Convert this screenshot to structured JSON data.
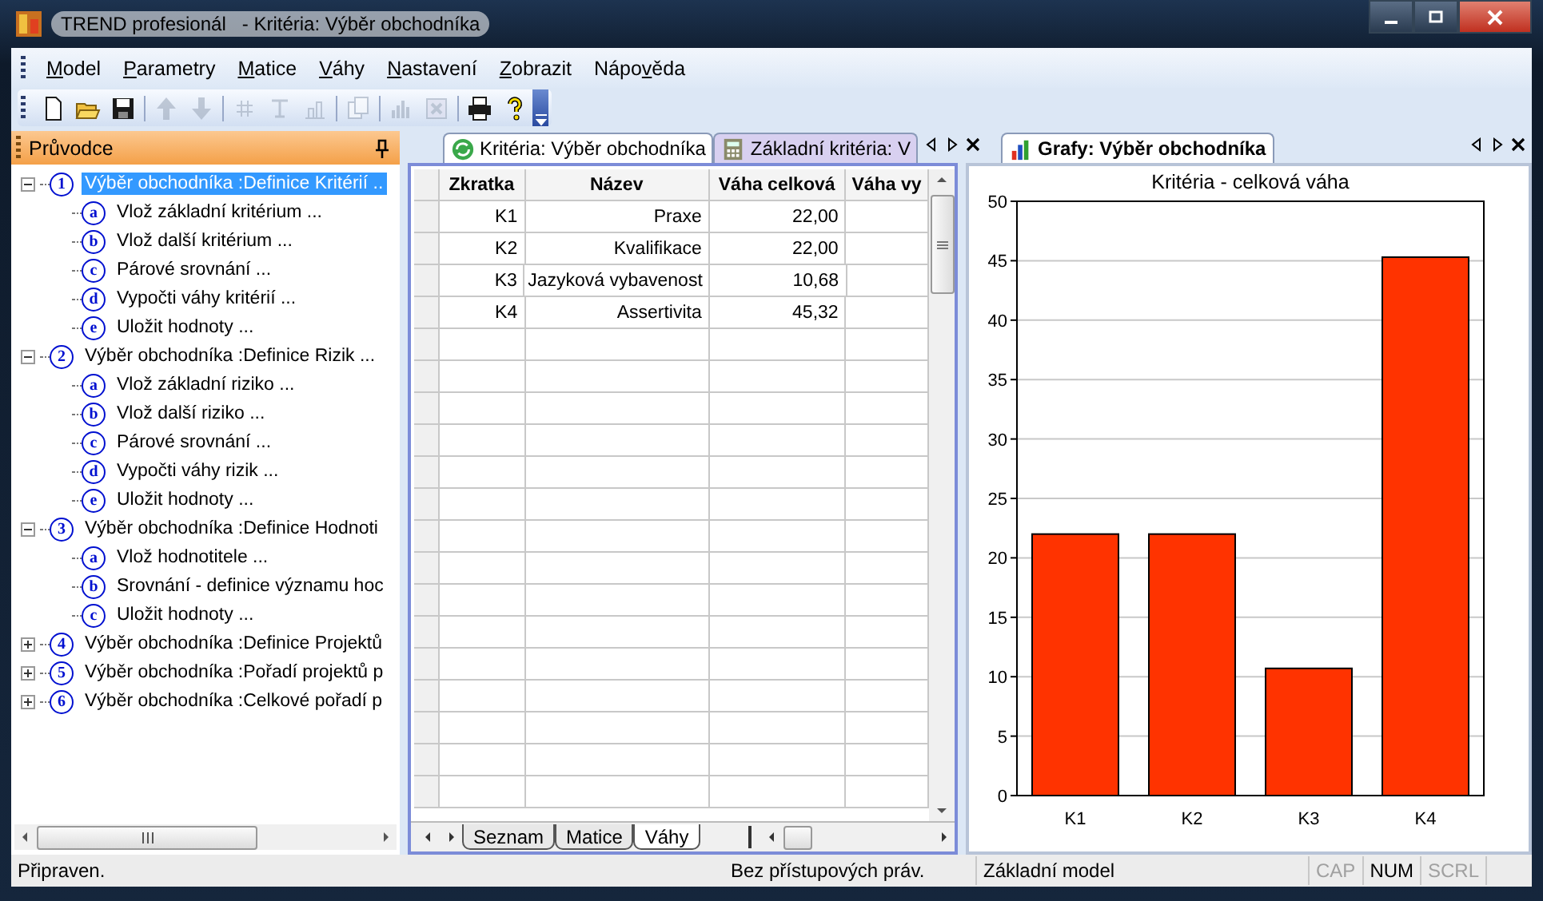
{
  "window": {
    "app_title": "TREND profesionál",
    "doc_title": "- Kritéria: Výběr obchodníka"
  },
  "menu": [
    {
      "access_key": "M",
      "rest": "odel"
    },
    {
      "access_key": "P",
      "rest": "arametry"
    },
    {
      "access_key": "M",
      "rest": "atice"
    },
    {
      "access_key": "V",
      "rest": "áhy"
    },
    {
      "access_key": "N",
      "rest": "astavení"
    },
    {
      "access_key": "Z",
      "rest": "obrazit"
    },
    {
      "before": "Nápo",
      "access_key": "v",
      "rest": "ěda"
    }
  ],
  "toolbar": [
    {
      "kind": "new",
      "disabled": false
    },
    {
      "kind": "open",
      "disabled": false
    },
    {
      "kind": "save",
      "disabled": false
    },
    {
      "kind": "separator"
    },
    {
      "kind": "up",
      "disabled": true
    },
    {
      "kind": "down",
      "disabled": true
    },
    {
      "kind": "separator"
    },
    {
      "kind": "hash",
      "disabled": true
    },
    {
      "kind": "text",
      "disabled": true
    },
    {
      "kind": "chart",
      "disabled": true
    },
    {
      "kind": "separator"
    },
    {
      "kind": "copy",
      "disabled": true
    },
    {
      "kind": "separator"
    },
    {
      "kind": "bars",
      "disabled": true
    },
    {
      "kind": "delete",
      "disabled": true
    },
    {
      "kind": "separator"
    },
    {
      "kind": "print",
      "disabled": false
    },
    {
      "kind": "help",
      "disabled": false
    }
  ],
  "wizard": {
    "title": "Průvodce",
    "items": [
      {
        "badge": "1",
        "label": "Výběr obchodníka :Definice Kritérií ..",
        "expanded": true,
        "selected": true,
        "children": [
          {
            "badge": "a",
            "label": "Vlož základní kritérium ...",
            "selected": false
          },
          {
            "badge": "b",
            "label": "Vlož další kritérium ...",
            "selected": false
          },
          {
            "badge": "c",
            "label": "Párové srovnání ...",
            "selected": false
          },
          {
            "badge": "d",
            "label": "Vypočti váhy kritérií ...",
            "selected": false
          },
          {
            "badge": "e",
            "label": "Uložit hodnoty ...",
            "selected": false
          }
        ]
      },
      {
        "badge": "2",
        "label": "Výběr obchodníka :Definice Rizik ...",
        "expanded": true,
        "selected": false,
        "children": [
          {
            "badge": "a",
            "label": "Vlož základní riziko ...",
            "selected": false
          },
          {
            "badge": "b",
            "label": "Vlož další riziko ...",
            "selected": false
          },
          {
            "badge": "c",
            "label": "Párové srovnání ...",
            "selected": false
          },
          {
            "badge": "d",
            "label": "Vypočti váhy rizik ...",
            "selected": false
          },
          {
            "badge": "e",
            "label": "Uložit hodnoty ...",
            "selected": false
          }
        ]
      },
      {
        "badge": "3",
        "label": "Výběr obchodníka :Definice Hodnoti",
        "expanded": true,
        "selected": false,
        "children": [
          {
            "badge": "a",
            "label": "Vlož hodnotitele ...",
            "selected": false
          },
          {
            "badge": "b",
            "label": "Srovnání - definice významu hoc",
            "selected": false
          },
          {
            "badge": "c",
            "label": "Uložit hodnoty ...",
            "selected": false
          }
        ]
      },
      {
        "badge": "4",
        "label": "Výběr obchodníka :Definice Projektů",
        "expanded": false,
        "selected": false
      },
      {
        "badge": "5",
        "label": "Výběr obchodníka :Pořadí projektů p",
        "expanded": false,
        "selected": false
      },
      {
        "badge": "6",
        "label": "Výběr obchodníka :Celkové pořadí p",
        "expanded": false,
        "selected": false
      }
    ]
  },
  "documents": {
    "tabs": [
      {
        "kind": "refresh",
        "label": "Kritéria: Výběr obchodníka",
        "selected": true
      },
      {
        "kind": "calculator",
        "label": "Základní kritéria: V",
        "selected": false
      }
    ],
    "table": {
      "columns": [
        "Zkratka",
        "Název",
        "Váha celková",
        "Váha vy"
      ],
      "rows": [
        [
          "K1",
          "Praxe",
          "22,00"
        ],
        [
          "K2",
          "Kvalifikace",
          "22,00"
        ],
        [
          "K3",
          "Jazyková vybavenost",
          "10,68"
        ],
        [
          "K4",
          "Assertivita",
          "45,32"
        ]
      ]
    },
    "sheet_tabs": [
      {
        "label": "Seznam",
        "selected": false
      },
      {
        "label": "Matice",
        "selected": false
      },
      {
        "label": "Váhy",
        "selected": true
      }
    ]
  },
  "graphs": {
    "tabs": [
      {
        "kind": "chart",
        "label": "Grafy: Výběr obchodníka",
        "selected": true
      }
    ],
    "chart_data": {
      "type": "bar",
      "title": "Kritéria - celková váha",
      "categories": [
        "K1",
        "K2",
        "K3",
        "K4"
      ],
      "series": [
        {
          "color": "#ff3300",
          "values": [
            22.0,
            22.0,
            10.7,
            45.3
          ]
        }
      ],
      "grid": true,
      "ylim": [
        0,
        50
      ],
      "yticks": [
        0,
        5,
        10,
        15,
        20,
        25,
        30,
        35,
        40,
        45,
        50
      ]
    }
  },
  "status_bar": {
    "message": "Připraven.",
    "rights": "Bez přístupových práv.",
    "model": "Základní model",
    "indicators": [
      {
        "label": "CAP",
        "disabled": true
      },
      {
        "label": "NUM",
        "disabled": false
      },
      {
        "label": "SCRL",
        "disabled": true
      }
    ]
  }
}
